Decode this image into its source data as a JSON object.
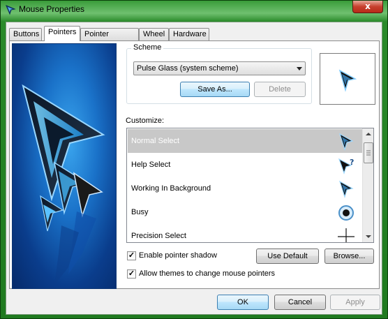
{
  "window": {
    "title": "Mouse Properties",
    "close_glyph": "x"
  },
  "tabs": [
    {
      "label": "Buttons",
      "active": false
    },
    {
      "label": "Pointers",
      "active": true
    },
    {
      "label": "Pointer Options",
      "active": false
    },
    {
      "label": "Wheel",
      "active": false
    },
    {
      "label": "Hardware",
      "active": false
    }
  ],
  "scheme": {
    "legend": "Scheme",
    "selected": "Pulse Glass (system scheme)",
    "save_as_label": "Save As...",
    "delete_label": "Delete"
  },
  "customize": {
    "label": "Customize:",
    "items": [
      {
        "label": "Normal Select",
        "icon": "arrow-cursor-icon",
        "selected": true
      },
      {
        "label": "Help Select",
        "icon": "help-cursor-icon",
        "selected": false
      },
      {
        "label": "Working In Background",
        "icon": "working-cursor-icon",
        "selected": false
      },
      {
        "label": "Busy",
        "icon": "busy-cursor-icon",
        "selected": false
      },
      {
        "label": "Precision Select",
        "icon": "crosshair-cursor-icon",
        "selected": false
      }
    ]
  },
  "options": {
    "pointer_shadow_label": "Enable pointer shadow",
    "pointer_shadow_checked": true,
    "allow_themes_label": "Allow themes to change mouse pointers",
    "allow_themes_checked": true,
    "use_default_label": "Use Default",
    "browse_label": "Browse..."
  },
  "footer": {
    "ok_label": "OK",
    "cancel_label": "Cancel",
    "apply_label": "Apply"
  },
  "colors": {
    "accent": "#3c7fb1",
    "selection": "#c8c8c8",
    "art_blue": "#1a72c9"
  }
}
